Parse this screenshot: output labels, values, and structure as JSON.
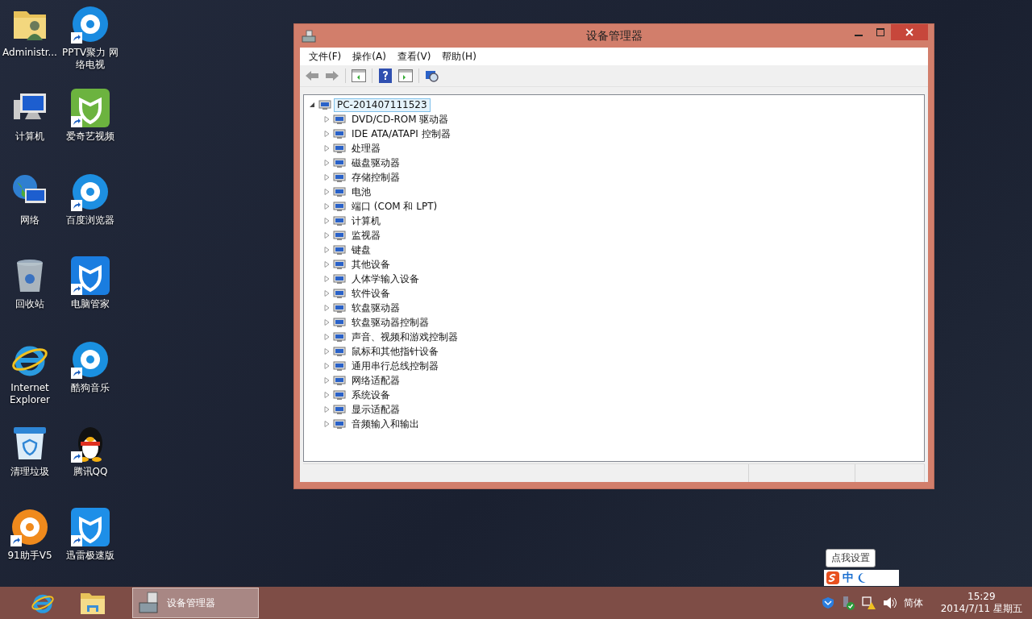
{
  "desktop_icons": [
    {
      "label": "Administr...",
      "kind": "folder",
      "shortcut": false
    },
    {
      "label": "PPTV聚力 网络电视",
      "kind": "disc",
      "color": "#1a8be0",
      "shortcut": true
    },
    {
      "label": "计算机",
      "kind": "computer",
      "shortcut": false
    },
    {
      "label": "爱奇艺视频",
      "kind": "tile",
      "color": "#6cb33f",
      "shortcut": true
    },
    {
      "label": "网络",
      "kind": "network",
      "shortcut": false
    },
    {
      "label": "百度浏览器",
      "kind": "disc",
      "color": "#1d8fe1",
      "shortcut": true
    },
    {
      "label": "回收站",
      "kind": "recycle",
      "shortcut": false
    },
    {
      "label": "电脑管家",
      "kind": "tile",
      "color": "#1a7de0",
      "shortcut": true
    },
    {
      "label": "Internet Explorer",
      "kind": "ie",
      "shortcut": false
    },
    {
      "label": "酷狗音乐",
      "kind": "disc",
      "color": "#1a90e0",
      "shortcut": true
    },
    {
      "label": "清理垃圾",
      "kind": "bin",
      "shortcut": false
    },
    {
      "label": "腾讯QQ",
      "kind": "penguin",
      "shortcut": true
    },
    {
      "label": "91助手V5",
      "kind": "disc",
      "color": "#f08a1c",
      "shortcut": true
    },
    {
      "label": "迅雷极速版",
      "kind": "tile",
      "color": "#1e8fe8",
      "shortcut": true
    }
  ],
  "window": {
    "title": "设备管理器",
    "menu": [
      "文件(F)",
      "操作(A)",
      "查看(V)",
      "帮助(H)"
    ],
    "tree": {
      "label": "PC-201407111523",
      "expanded": true,
      "selected": true,
      "children": [
        {
          "label": "DVD/CD-ROM 驱动器",
          "expanded": false
        },
        {
          "label": "IDE ATA/ATAPI 控制器",
          "expanded": false
        },
        {
          "label": "处理器",
          "expanded": false
        },
        {
          "label": "磁盘驱动器",
          "expanded": false
        },
        {
          "label": "存储控制器",
          "expanded": false
        },
        {
          "label": "电池",
          "expanded": false
        },
        {
          "label": "端口 (COM 和 LPT)",
          "expanded": false
        },
        {
          "label": "计算机",
          "expanded": false
        },
        {
          "label": "监视器",
          "expanded": false
        },
        {
          "label": "键盘",
          "expanded": false
        },
        {
          "label": "其他设备",
          "expanded": false
        },
        {
          "label": "人体学输入设备",
          "expanded": false
        },
        {
          "label": "软件设备",
          "expanded": false
        },
        {
          "label": "软盘驱动器",
          "expanded": false
        },
        {
          "label": "软盘驱动器控制器",
          "expanded": false
        },
        {
          "label": "声音、视频和游戏控制器",
          "expanded": false
        },
        {
          "label": "鼠标和其他指针设备",
          "expanded": false
        },
        {
          "label": "通用串行总线控制器",
          "expanded": false
        },
        {
          "label": "网络适配器",
          "expanded": false
        },
        {
          "label": "系统设备",
          "expanded": false
        },
        {
          "label": "显示适配器",
          "expanded": false
        },
        {
          "label": "音频输入和输出",
          "expanded": false
        }
      ]
    }
  },
  "ime": {
    "tooltip": "点我设置",
    "mode": "中"
  },
  "taskbar": {
    "pinned": [
      {
        "kind": "ie"
      },
      {
        "kind": "folder"
      }
    ],
    "buttons": [
      {
        "label": "设备管理器",
        "selected": true
      }
    ],
    "language": "简体",
    "time": "15:29",
    "date": "2014/7/11 星期五"
  }
}
